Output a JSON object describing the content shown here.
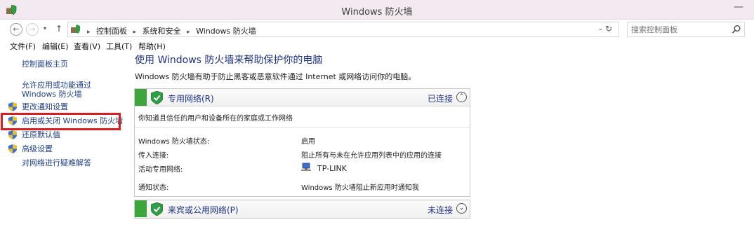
{
  "window": {
    "title": "Windows 防火墙",
    "minimize": "—"
  },
  "address": {
    "back": "←",
    "forward": "→",
    "dropdown": "▾",
    "up": "↑",
    "crumbs": [
      "控制面板",
      "系统和安全",
      "Windows 防火墙"
    ],
    "separator": "▸",
    "chevron": "⌄",
    "refresh": "↻",
    "search_placeholder": "搜索控制面板"
  },
  "menu": [
    "文件(F)",
    "编辑(E)",
    "查看(V)",
    "工具(T)",
    "帮助(H)"
  ],
  "sidebar": {
    "home": "控制面板主页",
    "allow_apps": "允许应用或功能通过 Windows 防火墙",
    "change_notify": "更改通知设置",
    "toggle_firewall": "启用或关闭 Windows 防火墙",
    "restore_defaults": "还原默认值",
    "advanced": "高级设置",
    "troubleshoot": "对网络进行疑难解答"
  },
  "main": {
    "title": "使用 Windows 防火墙来帮助保护你的电脑",
    "description": "Windows 防火墙有助于防止黑客或恶意软件通过 Internet 或网络访问你的电脑。",
    "private": {
      "title": "专用网络(R)",
      "status": "已连接",
      "toggle": "⌃",
      "note": "你知道且信任的用户和设备所在的家庭或工作网络",
      "rows": [
        {
          "label": "Windows 防火墙状态:",
          "value": "启用"
        },
        {
          "label": "传入连接:",
          "value": "阻止所有与未在允许应用列表中的应用的连接"
        },
        {
          "label": "活动专用网络:",
          "value": "TP-LINK"
        },
        {
          "label": "通知状态:",
          "value": "Windows 防火墙阻止新应用时通知我"
        }
      ]
    },
    "public": {
      "title": "来宾或公用网络(P)",
      "status": "未连接",
      "toggle": "⌄"
    }
  },
  "colors": {
    "accent_green": "#3ca63c",
    "link_blue": "#1e3f8a",
    "highlight_red": "#d81f1f"
  }
}
